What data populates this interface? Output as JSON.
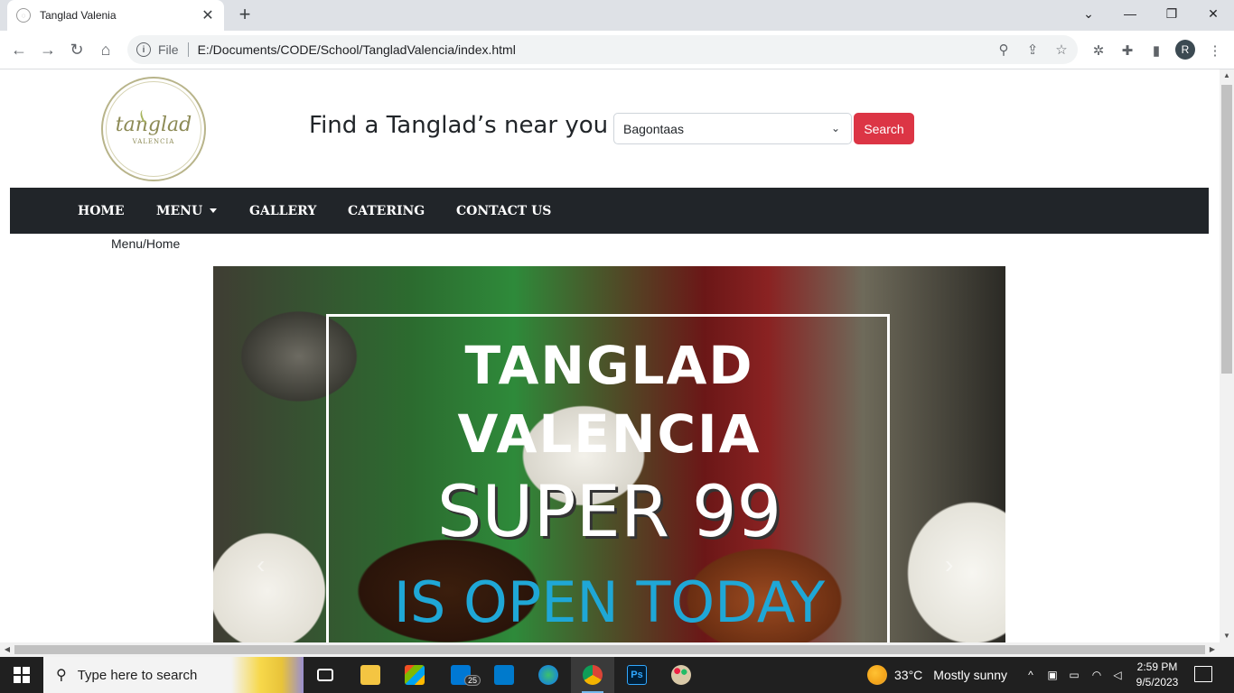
{
  "browser": {
    "tab_title": "Tanglad Valenia",
    "new_tab": "+",
    "omnibox_scheme": "File",
    "omnibox_url": "E:/Documents/CODE/School/TangladValencia/index.html",
    "profile_initial": "R",
    "window_controls": [
      "minimize",
      "restore",
      "close"
    ]
  },
  "site": {
    "logo_text": "tanglad",
    "logo_subtext": "VALENCIA",
    "find_title": "Find a Tanglad’s near you",
    "branch_select": "Bagontaas",
    "search_label": "Search",
    "nav": [
      {
        "label": "HOME"
      },
      {
        "label": "MENU"
      },
      {
        "label": "GALLERY"
      },
      {
        "label": "CATERING"
      },
      {
        "label": "CONTACT US"
      }
    ],
    "breadcrumb": "Menu/Home",
    "hero": {
      "line1": "TANGLAD",
      "line2": "VALENCIA",
      "line3": "SUPER 99",
      "line4": "IS OPEN TODAY",
      "accent_color": "#1fa7d6"
    }
  },
  "colors": {
    "navbar_bg": "#212529",
    "search_btn": "#dc3545"
  },
  "taskbar": {
    "search_placeholder": "Type here to search",
    "mail_badge": "25",
    "weather_temp": "33°C",
    "weather_desc": "Mostly sunny",
    "time": "2:59 PM",
    "date": "9/5/2023"
  }
}
